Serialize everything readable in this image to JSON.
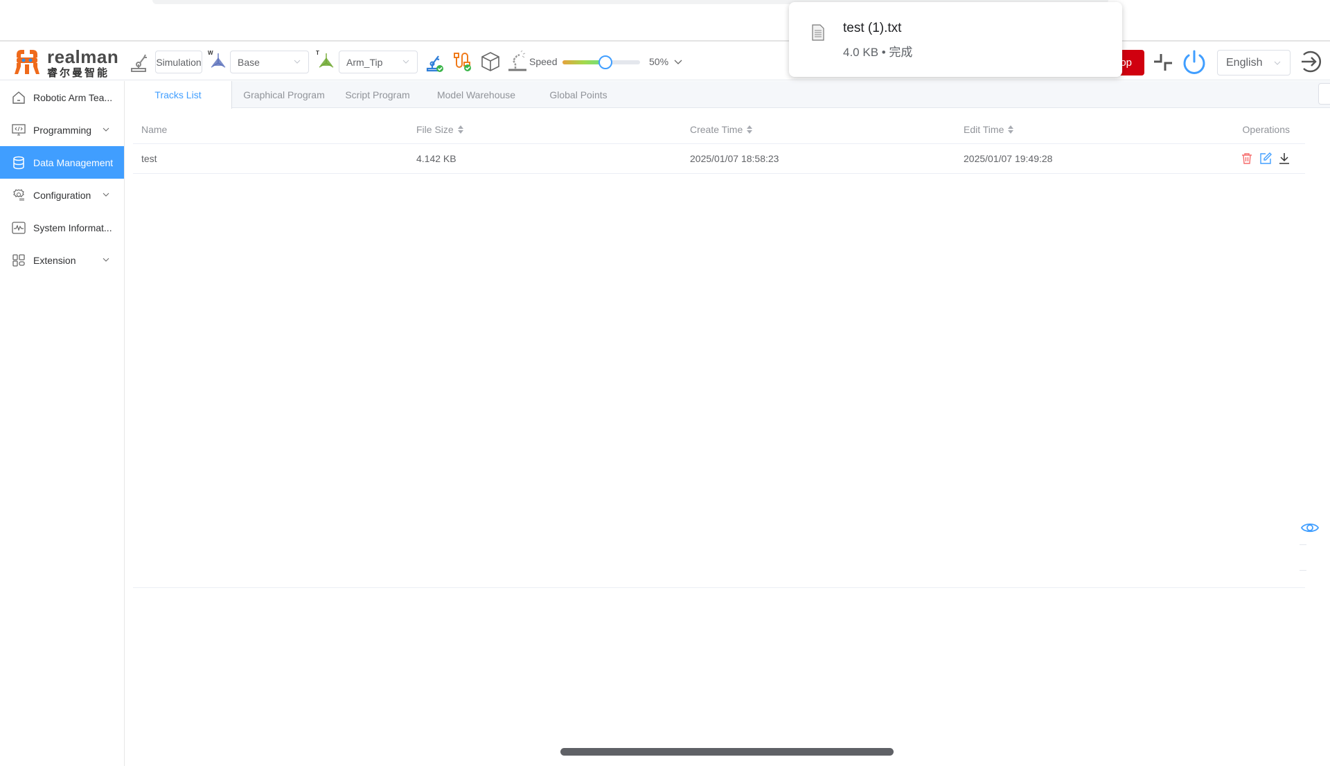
{
  "brand": {
    "name_en": "realman",
    "name_cn": "睿尔曼智能"
  },
  "header": {
    "mode_label": "Simulation",
    "work_frame": {
      "selected": "Base",
      "badge": "W"
    },
    "tool_frame": {
      "selected": "Arm_Tip",
      "badge": "T"
    },
    "speed_label": "Speed",
    "speed_value": "50%",
    "speed_fraction": 0.5,
    "estop_label": "Stop",
    "language": "English",
    "icons": [
      "robot-arm-icon",
      "work-frame-icon",
      "tool-frame-icon",
      "arm-connected-icon",
      "io-connected-icon",
      "model-cube-icon",
      "teach-arm-icon",
      "collapse-arrows-icon",
      "power-icon",
      "logout-icon"
    ]
  },
  "sidebar": {
    "items": [
      {
        "label": "Robotic Arm Tea...",
        "icon": "home-icon",
        "expandable": false,
        "active": false
      },
      {
        "label": "Programming",
        "icon": "code-monitor-icon",
        "expandable": true,
        "active": false
      },
      {
        "label": "Data Management",
        "icon": "database-icon",
        "expandable": false,
        "active": true
      },
      {
        "label": "Configuration",
        "icon": "settings-icon",
        "expandable": true,
        "active": false
      },
      {
        "label": "System Informat...",
        "icon": "pulse-monitor-icon",
        "expandable": false,
        "active": false
      },
      {
        "label": "Extension",
        "icon": "grid-apps-icon",
        "expandable": true,
        "active": false
      }
    ]
  },
  "tabs": [
    {
      "label": "Tracks List",
      "active": true
    },
    {
      "label": "Graphical Program",
      "active": false
    },
    {
      "label": "Script Program",
      "active": false
    },
    {
      "label": "Model Warehouse",
      "active": false
    },
    {
      "label": "Global Points",
      "active": false
    }
  ],
  "search": {
    "placeholder": "",
    "value": ""
  },
  "table": {
    "columns": [
      "Name",
      "File Size",
      "Create Time",
      "Edit Time",
      "Operations"
    ],
    "rows": [
      {
        "name": "test",
        "file_size": "4.142 KB",
        "create_time": "2025/01/07 18:58:23",
        "edit_time": "2025/01/07 19:49:28"
      }
    ]
  },
  "download_popup": {
    "filename": "test (1).txt",
    "meta": "4.0 KB • 完成"
  },
  "colors": {
    "accent": "#409eff",
    "estop": "#d0000f",
    "delete": "#f56c6c"
  }
}
